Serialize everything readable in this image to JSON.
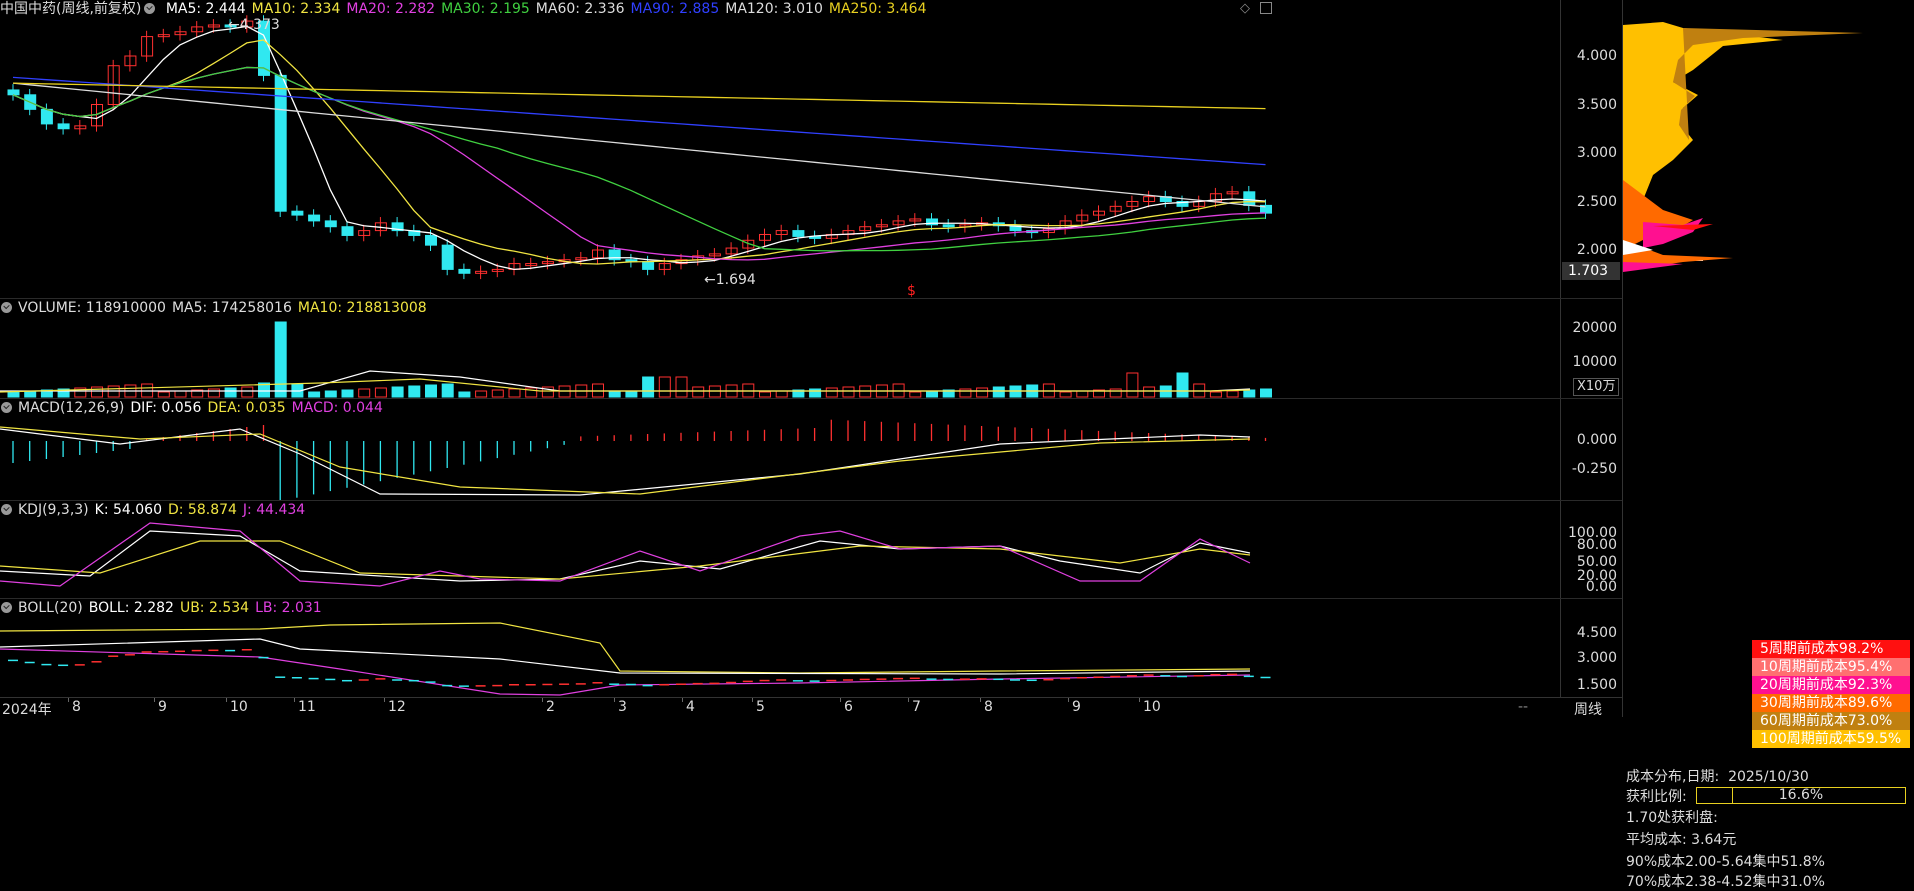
{
  "main": {
    "title": "中国中药(周线,前复权)",
    "ma": [
      {
        "label": "MA5: 2.444",
        "color": "#ffffff"
      },
      {
        "label": "MA10: 2.334",
        "color": "#f0e442"
      },
      {
        "label": "MA20: 2.282",
        "color": "#e040e0"
      },
      {
        "label": "MA30: 2.195",
        "color": "#40d040"
      },
      {
        "label": "MA60: 2.336",
        "color": "#dddddd"
      },
      {
        "label": "MA90: 2.885",
        "color": "#3040ff"
      },
      {
        "label": "MA120: 3.010",
        "color": "#dddddd"
      },
      {
        "label": "MA250: 3.464",
        "color": "#e8d020"
      }
    ],
    "ticks": [
      "4.000",
      "3.500",
      "3.000",
      "2.500",
      "2.000"
    ],
    "current_price": "1.703",
    "high_label": "4.373",
    "low_label": "1.694",
    "marker": "$"
  },
  "volume": {
    "labels": [
      {
        "text": "VOLUME: 118910000",
        "color": "#dddddd"
      },
      {
        "text": "MA5: 174258016",
        "color": "#dddddd"
      },
      {
        "text": "MA10: 218813008",
        "color": "#f0e442"
      }
    ],
    "ticks": [
      "20000",
      "10000"
    ],
    "unit": "X10万"
  },
  "macd": {
    "labels": [
      {
        "text": "MACD(12,26,9)",
        "color": "#dddddd"
      },
      {
        "text": "DIF: 0.056",
        "color": "#ffffff"
      },
      {
        "text": "DEA: 0.035",
        "color": "#f0e442"
      },
      {
        "text": "MACD: 0.044",
        "color": "#e040e0"
      }
    ],
    "ticks": [
      "0.000",
      "-0.250"
    ]
  },
  "kdj": {
    "labels": [
      {
        "text": "KDJ(9,3,3)",
        "color": "#dddddd"
      },
      {
        "text": "K: 54.060",
        "color": "#ffffff"
      },
      {
        "text": "D: 58.874",
        "color": "#f0e442"
      },
      {
        "text": "J: 44.434",
        "color": "#e040e0"
      }
    ],
    "ticks": [
      "100.00",
      "80.00",
      "50.00",
      "20.00",
      "0.00"
    ]
  },
  "boll": {
    "labels": [
      {
        "text": "BOLL(20)",
        "color": "#dddddd"
      },
      {
        "text": "BOLL: 2.282",
        "color": "#ffffff"
      },
      {
        "text": "UB: 2.534",
        "color": "#f0e442"
      },
      {
        "text": "LB: 2.031",
        "color": "#e040e0"
      }
    ],
    "ticks": [
      "4.500",
      "3.000",
      "1.500"
    ]
  },
  "xaxis": {
    "labels": [
      "2024年",
      "8",
      "9",
      "10",
      "11",
      "12",
      "2",
      "3",
      "4",
      "5",
      "6",
      "7",
      "8",
      "9",
      "10"
    ],
    "right": "--"
  },
  "chip_legend": [
    {
      "text": "5周期前成本98.2%",
      "color": "#ff1010"
    },
    {
      "text": "10周期前成本95.4%",
      "color": "#ff7070"
    },
    {
      "text": "20周期前成本92.3%",
      "color": "#ff1090"
    },
    {
      "text": "30周期前成本89.6%",
      "color": "#ff6a00"
    },
    {
      "text": "60周期前成本73.0%",
      "color": "#c08010"
    },
    {
      "text": "100周期前成本59.5%",
      "color": "#ffc000"
    }
  ],
  "chip_info": {
    "date_label": "成本分布,日期:",
    "date": "2025/10/30",
    "profit_label": "获利比例:",
    "profit_value": "16.6%",
    "profit_fraction": 0.166,
    "price_line": "1.70处获利盘:",
    "avg_cost": "平均成本: 3.64元",
    "cost90": "90%成本2.00-5.64集中51.8%",
    "cost70": "70%成本2.38-4.52集中31.0%"
  },
  "period": "周线",
  "colors": {
    "up": "#ff3030",
    "down": "#30e8f0",
    "bg": "#000000",
    "grid": "#3a1a1a"
  }
}
